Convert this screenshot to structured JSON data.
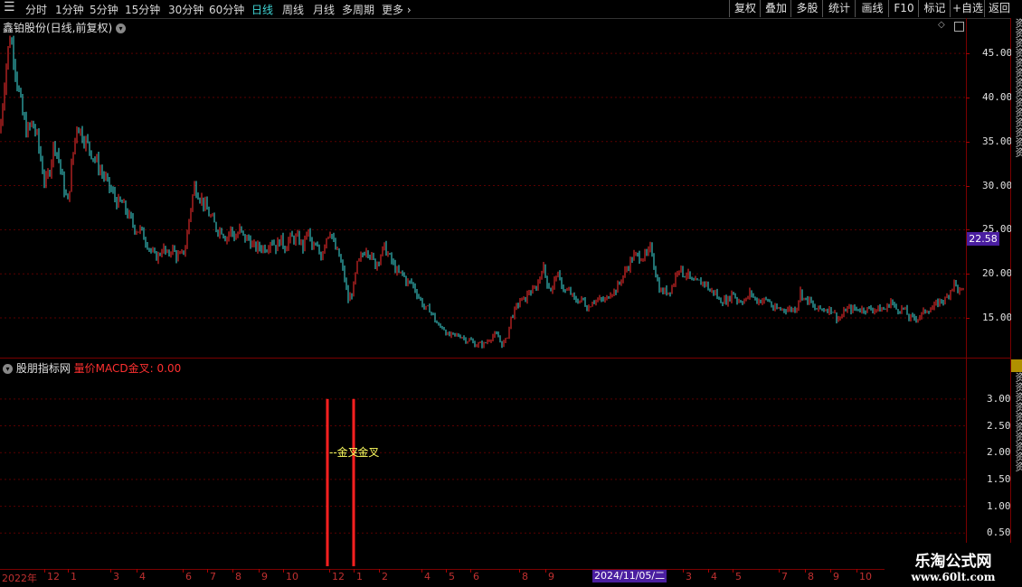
{
  "toolbar": {
    "periods": [
      "分时",
      "1分钟",
      "5分钟",
      "15分钟",
      "30分钟",
      "60分钟",
      "日线",
      "周线",
      "月线",
      "多周期",
      "更多"
    ],
    "active": "日线",
    "buttons": [
      "复权",
      "叠加",
      "多股",
      "统计",
      "画线",
      "F10",
      "标记",
      "+自选",
      "返回"
    ]
  },
  "main_chart": {
    "title": "鑫铂股份(日线,前复权)",
    "last_price": "22.58",
    "y_ticks": [
      "45.00",
      "40.00",
      "35.00",
      "30.00",
      "25.00",
      "20.00",
      "15.00"
    ],
    "up_color": "#ff3030",
    "down_color": "#40e0e0"
  },
  "indicator": {
    "source": "股朋指标网",
    "name": "量价MACD金叉:",
    "value": "0.00",
    "y_ticks": [
      "3.00",
      "2.50",
      "2.00",
      "1.50",
      "1.00",
      "0.50"
    ],
    "cross_text": "金叉",
    "cross_color": "#ff2020"
  },
  "x_axis": {
    "labels": [
      "2022年",
      "12",
      "1",
      "3",
      "4",
      "6",
      "7",
      "8",
      "9",
      "10",
      "12",
      "1",
      "2",
      "4",
      "5",
      "6",
      "8",
      "9",
      "3",
      "4",
      "5",
      "7",
      "8",
      "9",
      "10"
    ],
    "cursor_date": "2024/11/05/二"
  },
  "watermark": {
    "line1": "乐淘公式网",
    "line2": "www.60lt.com"
  },
  "chart_data": {
    "type": "candlestick",
    "title": "鑫铂股份(日线,前复权)",
    "ylim": [
      10.5,
      49
    ],
    "close_path": [
      [
        0,
        36
      ],
      [
        6,
        43
      ],
      [
        11,
        47
      ],
      [
        15,
        45
      ],
      [
        20,
        41
      ],
      [
        25,
        38
      ],
      [
        30,
        36
      ],
      [
        35,
        37
      ],
      [
        40,
        36
      ],
      [
        45,
        33
      ],
      [
        50,
        30
      ],
      [
        55,
        32
      ],
      [
        60,
        35
      ],
      [
        65,
        33
      ],
      [
        70,
        30
      ],
      [
        75,
        28
      ],
      [
        80,
        33
      ],
      [
        85,
        37
      ],
      [
        90,
        36
      ],
      [
        95,
        35
      ],
      [
        100,
        34
      ],
      [
        105,
        33
      ],
      [
        110,
        32
      ],
      [
        115,
        31
      ],
      [
        120,
        30
      ],
      [
        125,
        29
      ],
      [
        130,
        28
      ],
      [
        135,
        28
      ],
      [
        140,
        27
      ],
      [
        145,
        26
      ],
      [
        150,
        25
      ],
      [
        155,
        25
      ],
      [
        160,
        24
      ],
      [
        165,
        23
      ],
      [
        170,
        22
      ],
      [
        175,
        22
      ],
      [
        180,
        23
      ],
      [
        185,
        22
      ],
      [
        190,
        23
      ],
      [
        195,
        22
      ],
      [
        200,
        22
      ],
      [
        205,
        23
      ],
      [
        210,
        27
      ],
      [
        215,
        30
      ],
      [
        220,
        29
      ],
      [
        225,
        28
      ],
      [
        230,
        27
      ],
      [
        235,
        26
      ],
      [
        240,
        25
      ],
      [
        245,
        25
      ],
      [
        250,
        24
      ],
      [
        255,
        25
      ],
      [
        260,
        24
      ],
      [
        265,
        25
      ],
      [
        270,
        24
      ],
      [
        275,
        24
      ],
      [
        280,
        23
      ],
      [
        285,
        23
      ],
      [
        290,
        23
      ],
      [
        295,
        23
      ],
      [
        300,
        24
      ],
      [
        305,
        23
      ],
      [
        310,
        24
      ],
      [
        315,
        23
      ],
      [
        320,
        24
      ],
      [
        325,
        24
      ],
      [
        330,
        24
      ],
      [
        335,
        23
      ],
      [
        340,
        25
      ],
      [
        345,
        23
      ],
      [
        350,
        23
      ],
      [
        355,
        22
      ],
      [
        360,
        24
      ],
      [
        365,
        25
      ],
      [
        370,
        23
      ],
      [
        375,
        22
      ],
      [
        380,
        20
      ],
      [
        385,
        17
      ],
      [
        390,
        18
      ],
      [
        395,
        21
      ],
      [
        400,
        22
      ],
      [
        405,
        23
      ],
      [
        410,
        22
      ],
      [
        415,
        21
      ],
      [
        420,
        22
      ],
      [
        425,
        23
      ],
      [
        430,
        22
      ],
      [
        435,
        21
      ],
      [
        440,
        20
      ],
      [
        445,
        20
      ],
      [
        450,
        19
      ],
      [
        455,
        19
      ],
      [
        460,
        18
      ],
      [
        465,
        17
      ],
      [
        470,
        16
      ],
      [
        475,
        16
      ],
      [
        480,
        15
      ],
      [
        485,
        14
      ],
      [
        490,
        14
      ],
      [
        495,
        13
      ],
      [
        500,
        13
      ],
      [
        505,
        13
      ],
      [
        510,
        13
      ],
      [
        515,
        12.5
      ],
      [
        520,
        12.5
      ],
      [
        525,
        12
      ],
      [
        530,
        12
      ],
      [
        535,
        12
      ],
      [
        540,
        12.5
      ],
      [
        545,
        13
      ],
      [
        550,
        13
      ],
      [
        555,
        12
      ],
      [
        560,
        12.5
      ],
      [
        565,
        15
      ],
      [
        570,
        16
      ],
      [
        575,
        17
      ],
      [
        580,
        17
      ],
      [
        585,
        18
      ],
      [
        590,
        18
      ],
      [
        595,
        19
      ],
      [
        600,
        21
      ],
      [
        605,
        19
      ],
      [
        610,
        18
      ],
      [
        615,
        20
      ],
      [
        620,
        19
      ],
      [
        625,
        18
      ],
      [
        630,
        18
      ],
      [
        635,
        17
      ],
      [
        640,
        17
      ],
      [
        645,
        17
      ],
      [
        650,
        16
      ],
      [
        655,
        17
      ],
      [
        660,
        17
      ],
      [
        665,
        17
      ],
      [
        670,
        17
      ],
      [
        675,
        18
      ],
      [
        680,
        18
      ],
      [
        685,
        19
      ],
      [
        690,
        20
      ],
      [
        695,
        21
      ],
      [
        700,
        22
      ],
      [
        705,
        22
      ],
      [
        710,
        22
      ],
      [
        715,
        22
      ],
      [
        720,
        23
      ],
      [
        725,
        20
      ],
      [
        730,
        18
      ],
      [
        735,
        18
      ],
      [
        740,
        18
      ],
      [
        745,
        19
      ],
      [
        750,
        21
      ],
      [
        755,
        20
      ],
      [
        760,
        20
      ],
      [
        765,
        19
      ],
      [
        770,
        19
      ],
      [
        775,
        19
      ],
      [
        780,
        19
      ],
      [
        785,
        18
      ],
      [
        790,
        18
      ],
      [
        795,
        17
      ],
      [
        800,
        17
      ],
      [
        805,
        17
      ],
      [
        810,
        18
      ],
      [
        815,
        17
      ],
      [
        820,
        17
      ],
      [
        825,
        17
      ],
      [
        830,
        18
      ],
      [
        835,
        17
      ],
      [
        840,
        17
      ],
      [
        845,
        17
      ],
      [
        850,
        17
      ],
      [
        855,
        16
      ],
      [
        860,
        16
      ],
      [
        865,
        16
      ],
      [
        870,
        16
      ],
      [
        875,
        16
      ],
      [
        880,
        16
      ],
      [
        885,
        18
      ],
      [
        890,
        17
      ],
      [
        895,
        17
      ],
      [
        900,
        16
      ],
      [
        905,
        16
      ],
      [
        910,
        16
      ],
      [
        915,
        16
      ],
      [
        920,
        16
      ],
      [
        925,
        15
      ],
      [
        930,
        15
      ],
      [
        935,
        16
      ],
      [
        940,
        16
      ],
      [
        945,
        16
      ],
      [
        950,
        16
      ],
      [
        955,
        16
      ],
      [
        960,
        16
      ],
      [
        965,
        16
      ],
      [
        970,
        16
      ],
      [
        975,
        16
      ],
      [
        980,
        16
      ],
      [
        985,
        17
      ],
      [
        990,
        16
      ],
      [
        995,
        16
      ],
      [
        1000,
        16
      ],
      [
        1005,
        15
      ],
      [
        1010,
        15
      ],
      [
        1015,
        15
      ],
      [
        1020,
        15.5
      ],
      [
        1025,
        16
      ],
      [
        1030,
        16
      ],
      [
        1035,
        16.5
      ],
      [
        1040,
        17
      ],
      [
        1045,
        17
      ],
      [
        1050,
        18
      ],
      [
        1055,
        19
      ],
      [
        1060,
        18
      ],
      [
        1066,
        18
      ]
    ],
    "indicator_values": [
      3,
      3
    ],
    "indicator_signal_x": [
      362,
      391
    ]
  }
}
